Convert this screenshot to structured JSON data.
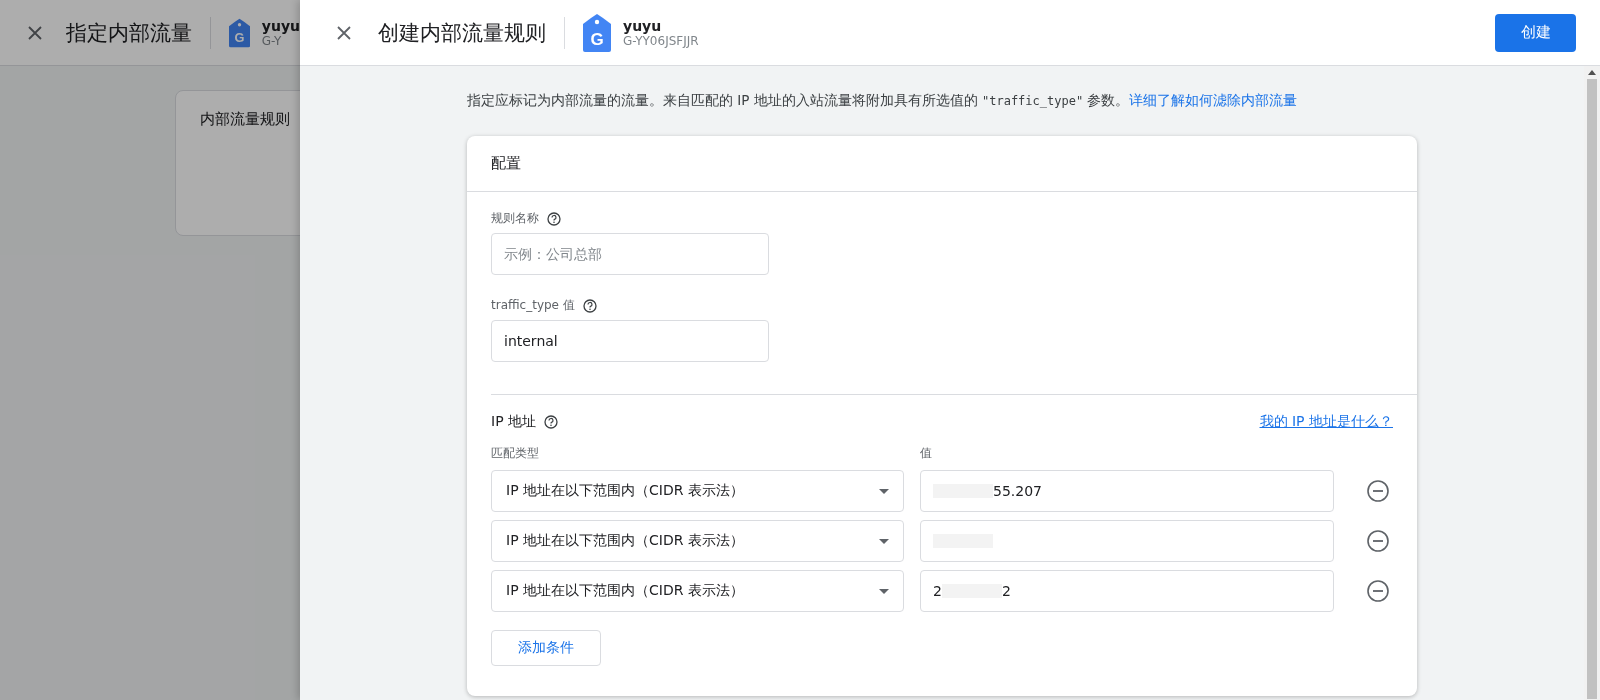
{
  "background_page": {
    "title": "指定内部流量",
    "logo_letter": "G",
    "property_name": "yuyu",
    "property_id": "G-Y",
    "card_title": "内部流量规则"
  },
  "drawer": {
    "title": "创建内部流量规则",
    "logo_letter": "G",
    "property_name": "yuyu",
    "property_id": "G-YY06JSFJJR",
    "primary_button": "创建",
    "description": {
      "before": "指定应标记为内部流量的流量。来自匹配的 IP 地址的入站流量将附加具有所选值的 ",
      "code": "\"traffic_type\"",
      "after": " 参数。",
      "link": "详细了解如何滤除内部流量"
    },
    "card": {
      "title": "配置",
      "fields": [
        {
          "label": "规则名称",
          "placeholder": "示例：公司总部"
        },
        {
          "label": "traffic_type 值",
          "value": "internal"
        }
      ],
      "ip_section": {
        "title": "IP 地址",
        "link": "我的 IP 地址是什么？",
        "column_1": "匹配类型",
        "column_2": "值",
        "rows": [
          {
            "match_type": "IP 地址在以下范围内（CIDR 表示法）",
            "value_parts": [
              {
                "kind": "redacted"
              },
              {
                "kind": "text",
                "text": "55.207"
              }
            ]
          },
          {
            "match_type": "IP 地址在以下范围内（CIDR 表示法）",
            "value_parts": [
              {
                "kind": "redacted"
              }
            ]
          },
          {
            "match_type": "IP 地址在以下范围内（CIDR 表示法）",
            "value_parts": [
              {
                "kind": "text",
                "text": "2"
              },
              {
                "kind": "redacted"
              },
              {
                "kind": "text",
                "text": "2"
              }
            ]
          }
        ],
        "add_button": "添加条件"
      }
    }
  }
}
